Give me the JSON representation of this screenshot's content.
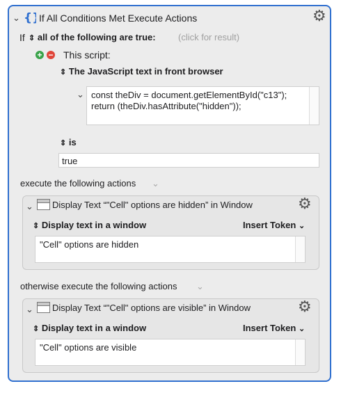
{
  "macro": {
    "title": "If All Conditions Met Execute Actions",
    "if_label": "If",
    "condition_mode": "all of the following are true:",
    "click_result": "(click for result)",
    "script_label": "This script:",
    "script_source": "The JavaScript text in front browser",
    "script_lines": [
      "const theDiv = document.getElementById(\"c13\");",
      "return (theDiv.hasAttribute(\"hidden\"));"
    ],
    "comparison": "is",
    "comparison_value": "true",
    "execute_label": "execute the following actions",
    "otherwise_label": "otherwise execute the following actions"
  },
  "actions": [
    {
      "title": "Display Text “\"Cell\" options are hidden” in Window",
      "mode": "Display text in a window",
      "insert_token": "Insert Token",
      "text": "\"Cell\" options are hidden"
    },
    {
      "title": "Display Text “\"Cell\" options are visible” in Window",
      "mode": "Display text in a window",
      "insert_token": "Insert Token",
      "text": "\"Cell\" options are visible"
    }
  ],
  "icons": {
    "accent": "#2f6fcf",
    "add": "#3aa34a",
    "remove": "#e0463a"
  }
}
